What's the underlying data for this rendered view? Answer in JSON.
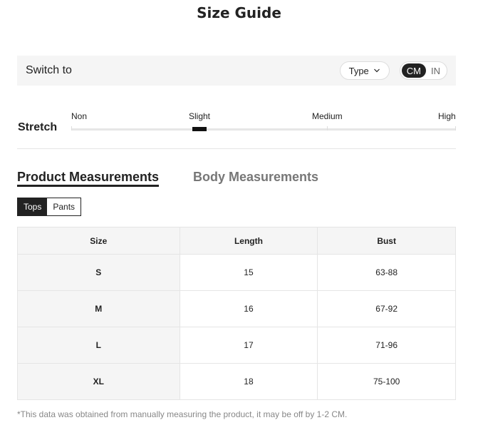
{
  "title": "Size Guide",
  "switch_bar": {
    "label": "Switch to",
    "type_select": "Type",
    "units": [
      "CM",
      "IN"
    ],
    "active_unit": "CM"
  },
  "stretch": {
    "label": "Stretch",
    "levels": [
      "Non",
      "Slight",
      "Medium",
      "High"
    ],
    "selected": "Slight"
  },
  "tabs": [
    {
      "label": "Product Measurements",
      "active": true
    },
    {
      "label": "Body Measurements",
      "active": false
    }
  ],
  "categories": [
    {
      "label": "Tops",
      "active": true
    },
    {
      "label": "Pants",
      "active": false
    }
  ],
  "table": {
    "headers": [
      "Size",
      "Length",
      "Bust"
    ],
    "rows": [
      [
        "S",
        "15",
        "63-88"
      ],
      [
        "M",
        "16",
        "67-92"
      ],
      [
        "L",
        "17",
        "71-96"
      ],
      [
        "XL",
        "18",
        "75-100"
      ]
    ]
  },
  "footnote": "*This data was obtained from manually measuring the product, it may be off by 1-2 CM."
}
